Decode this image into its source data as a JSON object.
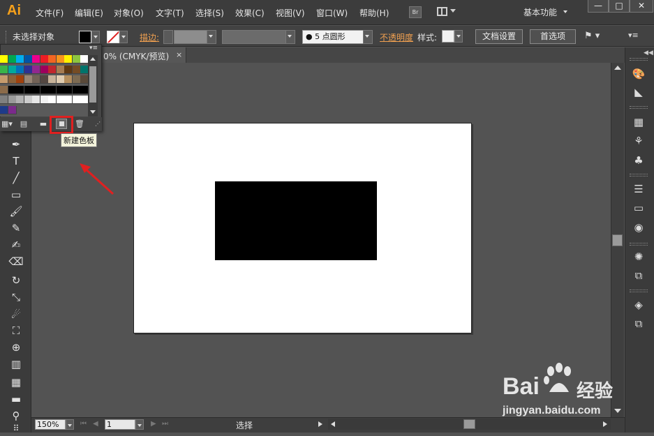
{
  "app": {
    "logo": "Ai"
  },
  "menu": {
    "items": [
      "文件(F)",
      "编辑(E)",
      "对象(O)",
      "文字(T)",
      "选择(S)",
      "效果(C)",
      "视图(V)",
      "窗口(W)",
      "帮助(H)"
    ],
    "bridge_label": "Br",
    "workspace": "基本功能",
    "window_buttons": [
      "—",
      "□",
      "✕"
    ]
  },
  "control_bar": {
    "selection_status": "未选择对象",
    "stroke_label": "描边:",
    "brush_value": "● 5 点圆形",
    "opacity_label": "不透明度",
    "style_label": "样式:",
    "doc_setup_button": "文档设置",
    "preferences_button": "首选项"
  },
  "document": {
    "tab_title": "0% (CMYK/预览)",
    "tab_close": "×"
  },
  "swatches_panel": {
    "menu_glyph": "▾≡",
    "tooltip": "新建色板",
    "footer_icons": [
      "swatch-library-icon",
      "swatch-kinds-icon",
      "folder-icon",
      "new-swatch-icon",
      "trash-icon"
    ],
    "rows": [
      [
        "#ffff00",
        "#00a651",
        "#00aeef",
        "#0054a6",
        "#ec008c",
        "#ed1c24",
        "#f26522",
        "#f7941d",
        "#fff200",
        "#8dc63f",
        "#ffffff"
      ],
      [
        "#39b54a",
        "#00a99d",
        "#0072bc",
        "#2e3192",
        "#92278f",
        "#9e005d",
        "#c1272d",
        "#a67c52",
        "#603913",
        "#754c24",
        "#00746b"
      ],
      [
        "#c69c6d",
        "#8c6239",
        "#a0410d",
        "#998675",
        "#736357",
        "#534741",
        "#c7b299",
        "#e0ccb0",
        "#b58f5e",
        "#7d6b52",
        "#5a4a3a"
      ],
      [
        "#8b6b4a",
        "#000000",
        "#000000",
        "#000000",
        "#000000",
        "#000000",
        "#000000",
        "#000000",
        "#000000",
        "#000000",
        "#000000"
      ],
      [
        "#808080",
        "#9a9a9a",
        "#b3b3b3",
        "#cccccc",
        "#e6e6e6",
        "#f2f2f2",
        "#ffffff",
        "#ffffff",
        "#ffffff",
        "#ffffff",
        "#ffffff"
      ],
      [
        "#1e3a8a",
        "#7b2a8c"
      ]
    ]
  },
  "status_bar": {
    "zoom": "150%",
    "page": "1",
    "status": "选择"
  },
  "watermark": {
    "brand": "Bai",
    "brand_suffix": "经验",
    "url": "jingyan.baidu.com"
  },
  "colors": {
    "accent_orange": "#f7a11a",
    "highlight_red": "#e02020",
    "artboard": "#ffffff",
    "shape_fill": "#000000"
  }
}
